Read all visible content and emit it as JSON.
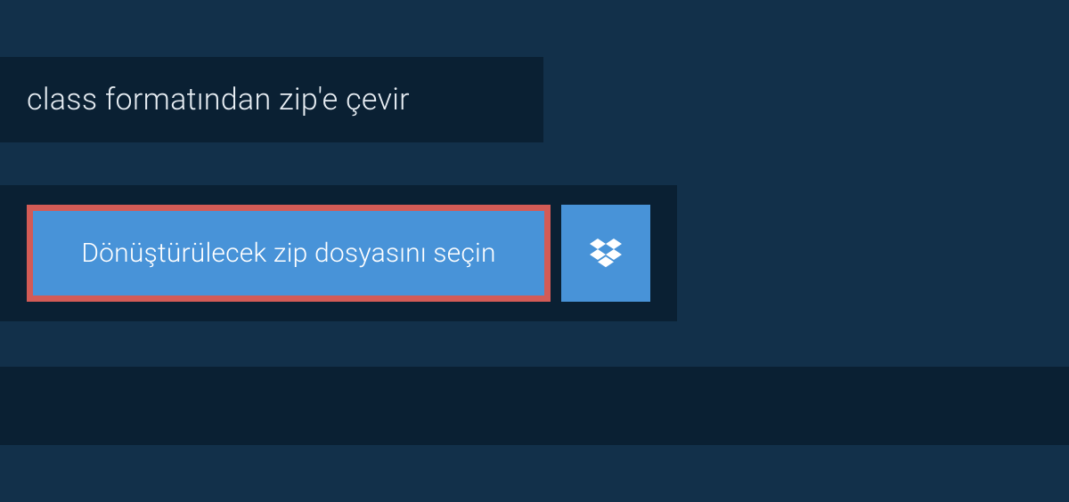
{
  "header": {
    "title": "class formatından zip'e çevir"
  },
  "upload": {
    "choose_label": "Dönüştürülecek zip dosyasını seçin",
    "dropbox_icon_name": "dropbox-icon"
  },
  "colors": {
    "bg_outer": "#12304a",
    "bg_panel": "#0a2033",
    "button_primary": "#4893d8",
    "button_highlight_border": "#d35b56",
    "text_light": "#e8eef4"
  }
}
